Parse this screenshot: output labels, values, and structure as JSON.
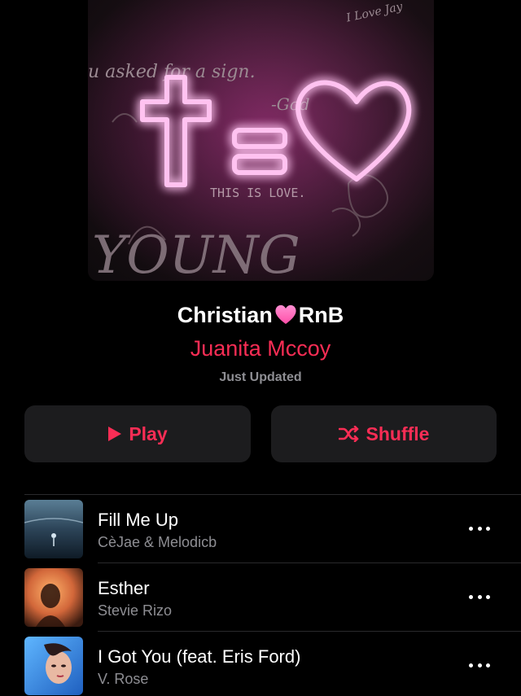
{
  "playlist": {
    "title_prefix": "Christian",
    "title_suffix": "RnB",
    "title_icon": "pink-heart-emoji",
    "curator": "Juanita Mccoy",
    "status": "Just Updated",
    "artwork_text": {
      "line1": "u asked for a sign.",
      "signature": "-God",
      "caption": "THIS IS LOVE.",
      "corner": "I Love Jay",
      "graffiti": "YOUNG"
    }
  },
  "actions": {
    "play_label": "Play",
    "play_icon": "play-icon",
    "shuffle_label": "Shuffle",
    "shuffle_icon": "shuffle-icon"
  },
  "tracks": [
    {
      "title": "Fill Me Up",
      "artist": "CèJae & Melodicb",
      "more_icon": "ellipsis-icon"
    },
    {
      "title": "Esther",
      "artist": "Stevie Rizo",
      "more_icon": "ellipsis-icon"
    },
    {
      "title": "I Got You (feat. Eris Ford)",
      "artist": "V. Rose",
      "more_icon": "ellipsis-icon"
    }
  ],
  "colors": {
    "accent": "#fa2d55",
    "background": "#000000",
    "button_bg": "#1c1c1e",
    "secondary_text": "#8e8e93",
    "neon": "#ff6ad5"
  }
}
